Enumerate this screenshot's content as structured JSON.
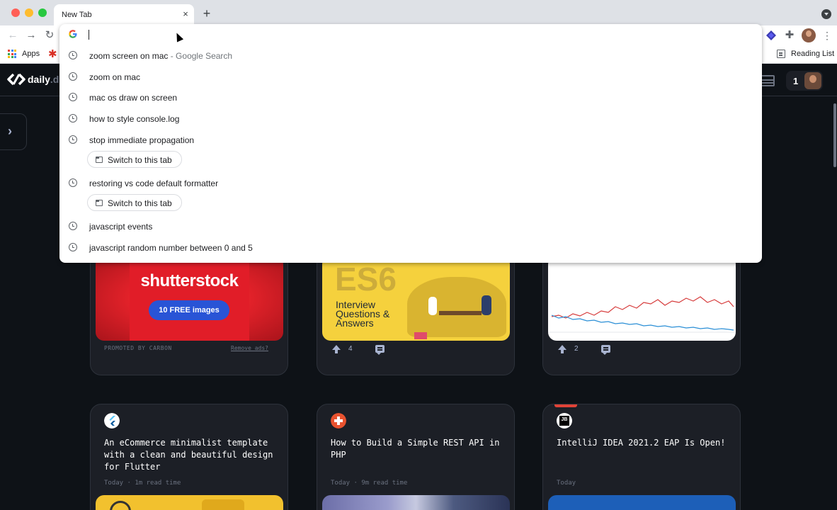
{
  "browser": {
    "tab_title": "New Tab",
    "tab_close": "×",
    "new_tab": "+",
    "bookmarks": {
      "apps_label": "Apps",
      "reading_list": "Reading List"
    }
  },
  "omnibox": {
    "value": "",
    "suggestions": [
      {
        "text": "zoom screen on mac",
        "description": " - Google Search"
      },
      {
        "text": "zoom on mac"
      },
      {
        "text": "mac os draw on screen"
      },
      {
        "text": "how to style console.log"
      },
      {
        "text": "stop immediate propagation",
        "switch": "Switch to this tab"
      },
      {
        "text": "restoring vs code default formatter",
        "switch": "Switch to this tab"
      },
      {
        "text": "javascript events"
      },
      {
        "text": "javascript random number between 0 and 5"
      }
    ]
  },
  "daily": {
    "logo": "daily",
    "logo_suffix": ".dev",
    "reputation": "1",
    "row1": [
      {
        "promo_label": "PROMOTED BY CARBON",
        "remove_ads": "Remove ads?",
        "image_brand": "shutterstock",
        "image_cta": "10 FREE images"
      },
      {
        "image_title": "ES6",
        "image_subtitle": "Interview Questions & Answers",
        "upvotes": "4"
      },
      {
        "upvotes": "2"
      }
    ],
    "row2": [
      {
        "title": "An eCommerce minimalist template with a clean and beautiful design for Flutter",
        "meta": "Today · 1m read time",
        "source_color": "#54c5f8"
      },
      {
        "title": "How to Build a Simple REST API in PHP",
        "meta": "Today · 9m read time",
        "source_color": "#e8522f"
      },
      {
        "title": "IntelliJ IDEA 2021.2 EAP Is Open!",
        "meta": "Today",
        "source_label": "JB",
        "source_color": "#000000"
      }
    ]
  }
}
